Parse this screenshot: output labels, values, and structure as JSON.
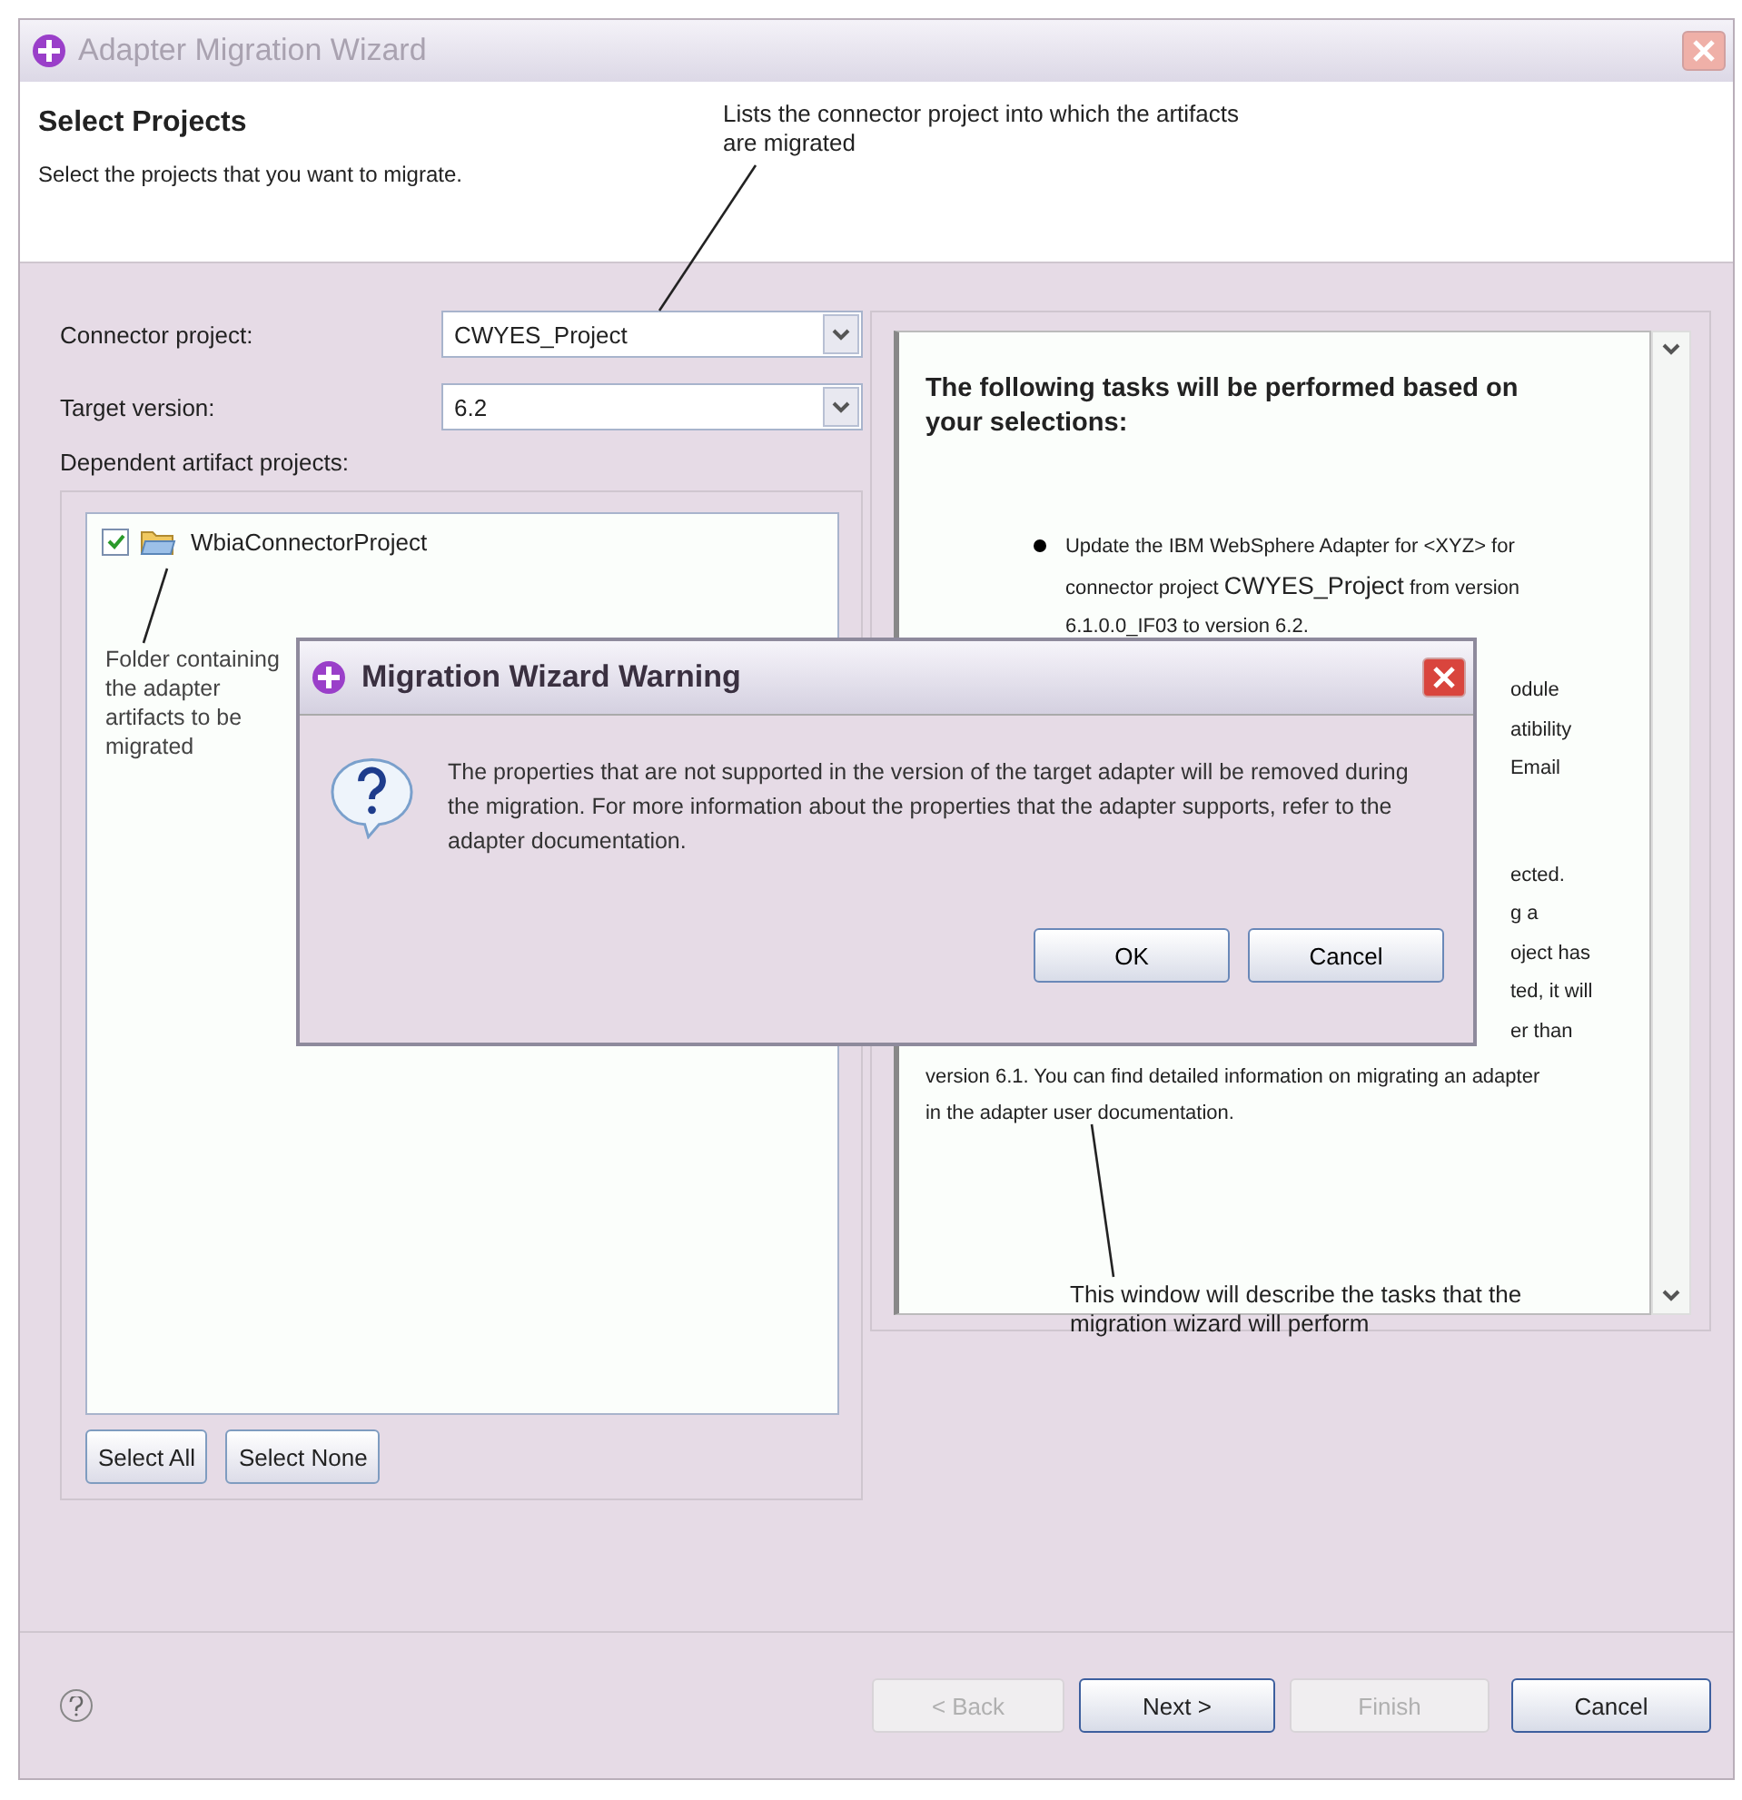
{
  "window": {
    "title": "Adapter Migration Wizard"
  },
  "header": {
    "title": "Select Projects",
    "subtitle": "Select the projects that you want to migrate."
  },
  "form": {
    "fields": [
      {
        "label": "Connector project:",
        "value": "CWYES_Project"
      },
      {
        "label": "Target version:",
        "value": "6.2"
      }
    ],
    "list_label": "Dependent artifact projects:",
    "projects": [
      {
        "name": "WbiaConnectorProject",
        "checked": true
      }
    ],
    "buttons": [
      "Select All",
      "Select None"
    ]
  },
  "tasks_panel": {
    "heading": "The following tasks will be performed based on your selections:",
    "items": [
      {
        "text": "Update the IBM WebSphere Adapter for <XYZ> for connector project",
        "project": "CWYES_Project",
        "rest": "from version 6.1.0.0_IF03 to version 6.2."
      }
    ],
    "covered_lines": [
      [
        "odule",
        "atibility",
        "Email"
      ],
      [
        "ected.",
        "g a",
        "oject has",
        "ted, it will",
        "er than"
      ]
    ],
    "closing": "version 6.1. You can find detailed information on migrating an adapter in the adapter user documentation."
  },
  "callouts": [
    "Lists the connector project into which the artifacts are migrated",
    "Folder containing the adapter artifacts to be migrated",
    "This window will describe the tasks that the migration wizard will perform"
  ],
  "footer": {
    "buttons": [
      {
        "label": "< Back",
        "disabled": true
      },
      {
        "label": "Next >",
        "disabled": false
      },
      {
        "label": "Finish",
        "disabled": true
      },
      {
        "label": "Cancel",
        "disabled": false
      }
    ]
  },
  "dialog": {
    "title": "Migration Wizard Warning",
    "message": "The properties that are not supported in the version of the target adapter will be removed during the migration. For more information about the properties that the adapter supports, refer to the adapter documentation.",
    "buttons": [
      "OK",
      "Cancel"
    ]
  }
}
